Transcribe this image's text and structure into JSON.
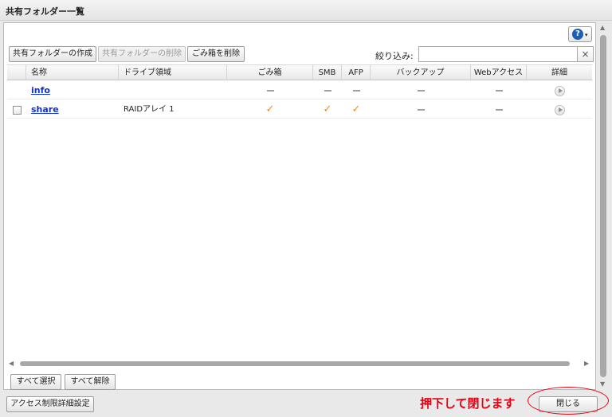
{
  "window": {
    "title": "共有フォルダー一覧"
  },
  "toolbar": {
    "create_label": "共有フォルダーの作成",
    "delete_label": "共有フォルダーの削除",
    "trash_label": "ごみ箱を削除",
    "filter_label": "絞り込み:",
    "filter_value": "",
    "filter_clear": "×"
  },
  "help": {
    "icon": "?",
    "caret": "▾"
  },
  "table": {
    "columns": [
      "名称",
      "ドライブ領域",
      "ごみ箱",
      "SMB",
      "AFP",
      "バックアップ",
      "Webアクセス",
      "詳細"
    ],
    "rows": [
      {
        "name": "info",
        "drive": "",
        "has_checkbox": false
      },
      {
        "name": "share",
        "drive": "RAIDアレイ 1",
        "has_checkbox": true
      }
    ]
  },
  "symbols": {
    "check": "✓"
  },
  "footer": {
    "select_all_label": "すべて選択",
    "deselect_all_label": "すべて解除",
    "access_label": "アクセス制限詳細設定",
    "close_label": "閉じる",
    "annotation": "押下して閉じます"
  },
  "colors": {
    "accent_orange": "#f08a1c",
    "link_blue": "#1133cc",
    "annotation_red": "#e60012"
  }
}
